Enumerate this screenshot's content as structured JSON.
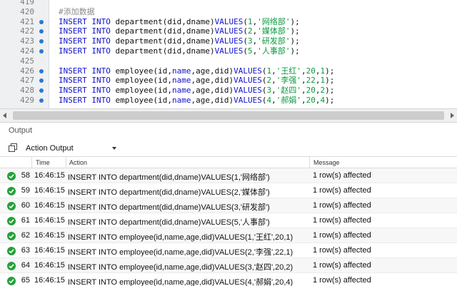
{
  "editor": {
    "lines": [
      {
        "num": "419",
        "marker": false,
        "parts": []
      },
      {
        "num": "420",
        "marker": false,
        "parts": [
          [
            "cmt",
            "#添加数据"
          ]
        ]
      },
      {
        "num": "421",
        "marker": true,
        "parts": [
          [
            "kw",
            "INSERT"
          ],
          [
            "pl",
            " "
          ],
          [
            "kw",
            "INTO"
          ],
          [
            "pl",
            " department(did,dname)"
          ],
          [
            "kw",
            "VALUES"
          ],
          [
            "pl",
            "("
          ],
          [
            "num",
            "1"
          ],
          [
            "pl",
            ","
          ],
          [
            "str",
            "'网络部'"
          ],
          [
            "pl",
            ");"
          ]
        ]
      },
      {
        "num": "422",
        "marker": true,
        "parts": [
          [
            "kw",
            "INSERT"
          ],
          [
            "pl",
            " "
          ],
          [
            "kw",
            "INTO"
          ],
          [
            "pl",
            " department(did,dname)"
          ],
          [
            "kw",
            "VALUES"
          ],
          [
            "pl",
            "("
          ],
          [
            "num",
            "2"
          ],
          [
            "pl",
            ","
          ],
          [
            "str",
            "'媒体部'"
          ],
          [
            "pl",
            ");"
          ]
        ]
      },
      {
        "num": "423",
        "marker": true,
        "parts": [
          [
            "kw",
            "INSERT"
          ],
          [
            "pl",
            " "
          ],
          [
            "kw",
            "INTO"
          ],
          [
            "pl",
            " department(did,dname)"
          ],
          [
            "kw",
            "VALUES"
          ],
          [
            "pl",
            "("
          ],
          [
            "num",
            "3"
          ],
          [
            "pl",
            ","
          ],
          [
            "str",
            "'研发部'"
          ],
          [
            "pl",
            ");"
          ]
        ]
      },
      {
        "num": "424",
        "marker": true,
        "parts": [
          [
            "kw",
            "INSERT"
          ],
          [
            "pl",
            " "
          ],
          [
            "kw",
            "INTO"
          ],
          [
            "pl",
            " department(did,dname)"
          ],
          [
            "kw",
            "VALUES"
          ],
          [
            "pl",
            "("
          ],
          [
            "num",
            "5"
          ],
          [
            "pl",
            ","
          ],
          [
            "str",
            "'人事部'"
          ],
          [
            "pl",
            ");"
          ]
        ]
      },
      {
        "num": "425",
        "marker": false,
        "parts": []
      },
      {
        "num": "426",
        "marker": true,
        "parts": [
          [
            "kw",
            "INSERT"
          ],
          [
            "pl",
            " "
          ],
          [
            "kw",
            "INTO"
          ],
          [
            "pl",
            " employee(id,"
          ],
          [
            "kw",
            "name"
          ],
          [
            "pl",
            ",age,did)"
          ],
          [
            "kw",
            "VALUES"
          ],
          [
            "pl",
            "("
          ],
          [
            "num",
            "1"
          ],
          [
            "pl",
            ","
          ],
          [
            "str",
            "'王红'"
          ],
          [
            "pl",
            ","
          ],
          [
            "num",
            "20"
          ],
          [
            "pl",
            ","
          ],
          [
            "num",
            "1"
          ],
          [
            "pl",
            ");"
          ]
        ]
      },
      {
        "num": "427",
        "marker": true,
        "parts": [
          [
            "kw",
            "INSERT"
          ],
          [
            "pl",
            " "
          ],
          [
            "kw",
            "INTO"
          ],
          [
            "pl",
            " employee(id,"
          ],
          [
            "kw",
            "name"
          ],
          [
            "pl",
            ",age,did)"
          ],
          [
            "kw",
            "VALUES"
          ],
          [
            "pl",
            "("
          ],
          [
            "num",
            "2"
          ],
          [
            "pl",
            ","
          ],
          [
            "str",
            "'李强'"
          ],
          [
            "pl",
            ","
          ],
          [
            "num",
            "22"
          ],
          [
            "pl",
            ","
          ],
          [
            "num",
            "1"
          ],
          [
            "pl",
            ");"
          ]
        ]
      },
      {
        "num": "428",
        "marker": true,
        "parts": [
          [
            "kw",
            "INSERT"
          ],
          [
            "pl",
            " "
          ],
          [
            "kw",
            "INTO"
          ],
          [
            "pl",
            " employee(id,"
          ],
          [
            "kw",
            "name"
          ],
          [
            "pl",
            ",age,did)"
          ],
          [
            "kw",
            "VALUES"
          ],
          [
            "pl",
            "("
          ],
          [
            "num",
            "3"
          ],
          [
            "pl",
            ","
          ],
          [
            "str",
            "'赵四'"
          ],
          [
            "pl",
            ","
          ],
          [
            "num",
            "20"
          ],
          [
            "pl",
            ","
          ],
          [
            "num",
            "2"
          ],
          [
            "pl",
            ");"
          ]
        ]
      },
      {
        "num": "429",
        "marker": true,
        "parts": [
          [
            "kw",
            "INSERT"
          ],
          [
            "pl",
            " "
          ],
          [
            "kw",
            "INTO"
          ],
          [
            "pl",
            " employee(id,"
          ],
          [
            "kw",
            "name"
          ],
          [
            "pl",
            ",age,did)"
          ],
          [
            "kw",
            "VALUES"
          ],
          [
            "pl",
            "("
          ],
          [
            "num",
            "4"
          ],
          [
            "pl",
            ","
          ],
          [
            "str",
            "'郝娟'"
          ],
          [
            "pl",
            ","
          ],
          [
            "num",
            "20"
          ],
          [
            "pl",
            ","
          ],
          [
            "num",
            "4"
          ],
          [
            "pl",
            ");"
          ]
        ]
      }
    ]
  },
  "output": {
    "title": "Output",
    "dropdown_label": "Action Output",
    "columns": {
      "time": "Time",
      "action": "Action",
      "message": "Message"
    },
    "rows": [
      {
        "num": "58",
        "time": "16:46:15",
        "action": "INSERT INTO department(did,dname)VALUES(1,'网络部')",
        "message": "1 row(s) affected"
      },
      {
        "num": "59",
        "time": "16:46:15",
        "action": "INSERT INTO department(did,dname)VALUES(2,'媒体部')",
        "message": "1 row(s) affected"
      },
      {
        "num": "60",
        "time": "16:46:15",
        "action": "INSERT INTO department(did,dname)VALUES(3,'研发部')",
        "message": "1 row(s) affected"
      },
      {
        "num": "61",
        "time": "16:46:15",
        "action": "INSERT INTO department(did,dname)VALUES(5,'人事部')",
        "message": "1 row(s) affected"
      },
      {
        "num": "62",
        "time": "16:46:15",
        "action": "INSERT INTO employee(id,name,age,did)VALUES(1,'王红',20,1)",
        "message": "1 row(s) affected"
      },
      {
        "num": "63",
        "time": "16:46:15",
        "action": "INSERT INTO employee(id,name,age,did)VALUES(2,'李强',22,1)",
        "message": "1 row(s) affected"
      },
      {
        "num": "64",
        "time": "16:46:15",
        "action": "INSERT INTO employee(id,name,age,did)VALUES(3,'赵四',20,2)",
        "message": "1 row(s) affected"
      },
      {
        "num": "65",
        "time": "16:46:15",
        "action": "INSERT INTO employee(id,name,age,did)VALUES(4,'郝娟',20,4)",
        "message": "1 row(s) affected"
      }
    ]
  },
  "colors": {
    "keyword": "#1414c8",
    "string": "#0a9a3e",
    "success": "#25a03a",
    "marker": "#2b78d6"
  },
  "icons": {
    "row_status": "success-check-icon",
    "toolbar": "copy-output-icon",
    "dropdown": "chevron-down-icon"
  }
}
